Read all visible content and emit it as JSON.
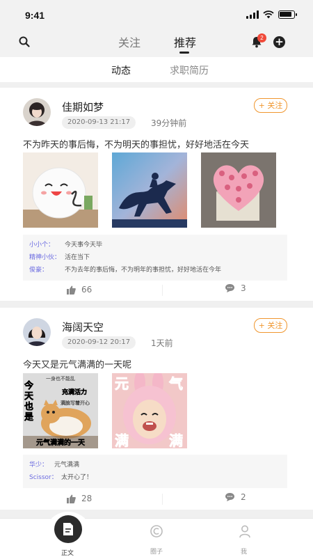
{
  "status_bar": {
    "time": "9:41"
  },
  "top_nav": {
    "tabs": [
      "关注",
      "推荐"
    ],
    "active_tab": "推荐",
    "notification_count": "2"
  },
  "sub_tabs": [
    "动态",
    "求职简历"
  ],
  "posts": [
    {
      "username": "佳期如梦",
      "date": "2020-09-13 21:17",
      "ago": "39分钟前",
      "follow_label": "+ 关注",
      "content": "不为昨天的事后悔，不为明天的事担忧，好好地活在今天",
      "photos": [
        "smiling-cushion",
        "horse-rider-silhouette",
        "pink-flower-heart"
      ],
      "comments": [
        {
          "name": "小小个：",
          "text": "今天事今天毕"
        },
        {
          "name": "精神小伙：",
          "text": "活在当下"
        },
        {
          "name": "俊豪：",
          "text": "不为去年的事后悔，不为明年的事担忧，好好地活在今年"
        }
      ],
      "likes": "66",
      "comment_count": "3"
    },
    {
      "username": "海阔天空",
      "date": "2020-09-12 20:17",
      "ago": "1天前",
      "follow_label": "+ 关注",
      "content": "今天又是元气满满的一天呢",
      "photos": [
        "cat-meme",
        "child-bunny-hat"
      ],
      "meme1": {
        "top": "一身也不能乱",
        "left1": "今",
        "left2": "天",
        "left3": "也",
        "left4": "是",
        "r1": "充满活力",
        "r2": "满脸写着开心",
        "bottom": "元气满满的一天"
      },
      "meme2": {
        "tl": "元",
        "tr": "气",
        "bl": "满",
        "br": "满"
      },
      "comments": [
        {
          "name": "华少：",
          "text": "元气满满"
        },
        {
          "name": "Scissor：",
          "text": "太开心了！"
        }
      ],
      "likes": "28",
      "comment_count": "2"
    }
  ],
  "bottom_bar": {
    "items": [
      "正文",
      "圈子",
      "我"
    ]
  }
}
